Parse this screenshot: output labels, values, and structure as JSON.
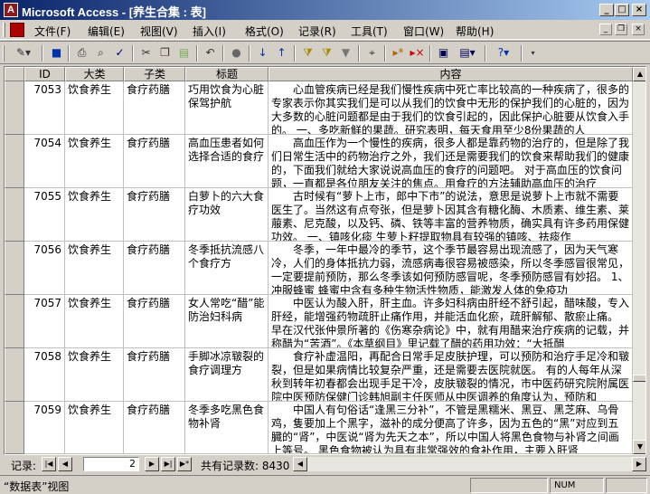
{
  "window": {
    "title": "Microsoft Access - [养生合集 : 表]",
    "app_icon": "A",
    "minimize_icon": "_",
    "maximize_icon": "□",
    "close_icon": "×"
  },
  "menu": [
    {
      "label": "文件(F)"
    },
    {
      "label": "编辑(E)"
    },
    {
      "label": "视图(V)"
    },
    {
      "label": "插入(I)"
    },
    {
      "label": "格式(O)"
    },
    {
      "label": "记录(R)"
    },
    {
      "label": "工具(T)"
    },
    {
      "label": "窗口(W)"
    },
    {
      "label": "帮助(H)"
    }
  ],
  "toolbar_icons": [
    "view-icon",
    "save-icon",
    "print-icon",
    "print-preview-icon",
    "spelling-icon",
    "cut-icon",
    "copy-icon",
    "paste-icon",
    "undo-icon",
    "hyperlink-icon",
    "sort-ascending-icon",
    "sort-descending-icon",
    "filter-by-selection-icon",
    "filter-by-form-icon",
    "apply-filter-icon",
    "find-icon",
    "new-record-icon",
    "delete-record-icon",
    "database-window-icon",
    "new-object-icon",
    "help-icon"
  ],
  "columns": [
    "ID",
    "大类",
    "子类",
    "标题",
    "内容"
  ],
  "rows": [
    {
      "id": "7053",
      "category": "饮食养生",
      "subcategory": "食疗药膳",
      "title": "巧用饮食为心脏保驾护航",
      "content": "心血管疾病已经是我们慢性疾病中死亡率比较高的一种疾病了，很多的专家表示你其实我们是可以从我们的饮食中无形的保护我们的心脏的，因为大多数的心脏问题都是由于我们的饮食引起的，因此保护心脏要从饮食入手的。 一、多吃新鲜的果蔬。研究表明，每天食用至少8份果蔬的人"
    },
    {
      "id": "7054",
      "category": "饮食养生",
      "subcategory": "食疗药膳",
      "title": "高血压患者如何选择合适的食疗",
      "content": "高血压作为一个慢性的疾病，很多人都是靠药物的治疗的，但是除了我们日常生活中的药物治疗之外，我们还是需要我们的饮食来帮助我们的健康的，下面我们就给大家说说高血压的食疗的问题吧。 对于高血压的饮食问题，一直都是各位朋友关注的焦点。用食疗的方法辅助高血压的治疗"
    },
    {
      "id": "7055",
      "category": "饮食养生",
      "subcategory": "食疗药膳",
      "title": "白萝卜的六大食疗功效",
      "content": "古时候有“萝卜上市，郎中下市”的说法，意思是说萝卜上市就不需要医生了。当然这有点夸张，但是萝卜因其含有糖化酶、木质素、维生素、莱菔素、尼克酸，以及钙、磷、铁等丰富的营养物质，确实具有许多药用保健功效。 一、镇咳化痰 生萝卜籽提取物具有较强的镇咳、祛痰作"
    },
    {
      "id": "7056",
      "category": "饮食养生",
      "subcategory": "食疗药膳",
      "title": "冬季抵抗流感八个食疗方",
      "content": "冬季，一年中最冷的季节，这个季节最容易出现流感了，因为天气寒冷，人们的身体抵抗力弱，流感病毒很容易被感染，所以冬季感冒很常见，一定要提前预防，那么冬季该如何预防感冒呢，冬季预防感冒有妙招。 1、冲服蜂蜜 蜂蜜中含有多种生物活性物质，能激发人体的免疫功"
    },
    {
      "id": "7057",
      "category": "饮食养生",
      "subcategory": "食疗药膳",
      "title": "女人常吃“醋”能防治妇科病",
      "content": "中医认为酸入肝，肝主血。许多妇科病由肝经不舒引起，醋味酸，专入肝经，能增强药物疏肝止痛作用，并能活血化瘀，疏肝解郁、散瘀止痛。 早在汉代张仲景所著的《伤寒杂病论》中，就有用醋来治疗疾病的记载，并称醋为“苦酒”。《本草纲目》里记载了醋的药用功效：“大抵醋"
    },
    {
      "id": "7058",
      "category": "饮食养生",
      "subcategory": "食疗药膳",
      "title": "手脚冰凉皲裂的食疗调理方",
      "content": "食疗补虚温阳，再配合日常手足皮肤护理，可以预防和治疗手足冷和皲裂，但是如果病情比较复杂严重，还是需要去医院就医。 有的人每年从深秋到转年初春都会出现手足干冷，皮肤皲裂的情况，市中医药研究院附属医院中医预防保健门诊韩旭副主任医师从中医调养的角度认为，预防和"
    },
    {
      "id": "7059",
      "category": "饮食养生",
      "subcategory": "食疗药膳",
      "title": "冬季多吃黑色食物补肾",
      "content": "中国人有句俗话“逢黑三分补”，不管是黑糯米、黑豆、黑芝麻、乌骨鸡，隻要加上个黑字，滋补的成分便高了许多，因为五色的“黑”对应到五臓的“肾”，中医说“肾为先天之本”，所以中国人将黑色食物与补肾之间画上等号。 黑色食物被认为具有非常强效的食补作用，主要入肝肾"
    }
  ],
  "navigator": {
    "label": "记录:",
    "current_record": "2",
    "total_label": "共有记录数: 8430",
    "first_icon": "|◀",
    "prev_icon": "◀",
    "next_icon": "▶",
    "last_icon": "▶|",
    "new_icon": "▶*"
  },
  "status": {
    "view_text": "“数据表”视图",
    "num_indicator": "NUM"
  }
}
